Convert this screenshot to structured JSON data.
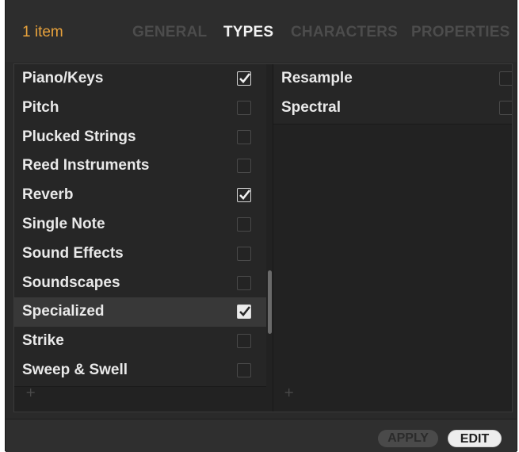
{
  "header": {
    "item_count": "1 item",
    "tabs": [
      {
        "label": "GENERAL",
        "active": false
      },
      {
        "label": "TYPES",
        "active": true
      },
      {
        "label": "CHARACTERS",
        "active": false
      },
      {
        "label": "PROPERTIES",
        "active": false
      }
    ]
  },
  "left_list": {
    "items": [
      {
        "label": "Piano/Keys",
        "checked": true
      },
      {
        "label": "Pitch",
        "checked": false
      },
      {
        "label": "Plucked Strings",
        "checked": false
      },
      {
        "label": "Reed Instruments",
        "checked": false
      },
      {
        "label": "Reverb",
        "checked": true
      },
      {
        "label": "Single Note",
        "checked": false
      },
      {
        "label": "Sound Effects",
        "checked": false
      },
      {
        "label": "Soundscapes",
        "checked": false
      },
      {
        "label": "Specialized",
        "checked": true,
        "selected": true
      },
      {
        "label": "Strike",
        "checked": false
      },
      {
        "label": "Sweep & Swell",
        "checked": false
      }
    ],
    "add_symbol": "+"
  },
  "right_list": {
    "items": [
      {
        "label": "Resample",
        "checked": false
      },
      {
        "label": "Spectral",
        "checked": false
      }
    ],
    "add_symbol": "+"
  },
  "footer": {
    "apply_label": "APPLY",
    "edit_label": "EDIT"
  },
  "colors": {
    "accent": "#e8a23c",
    "active_tab": "#f2f2f2",
    "inactive_tab": "#4c4c4c"
  },
  "icons": {
    "check": "checkmark-icon",
    "add": "plus-icon"
  }
}
